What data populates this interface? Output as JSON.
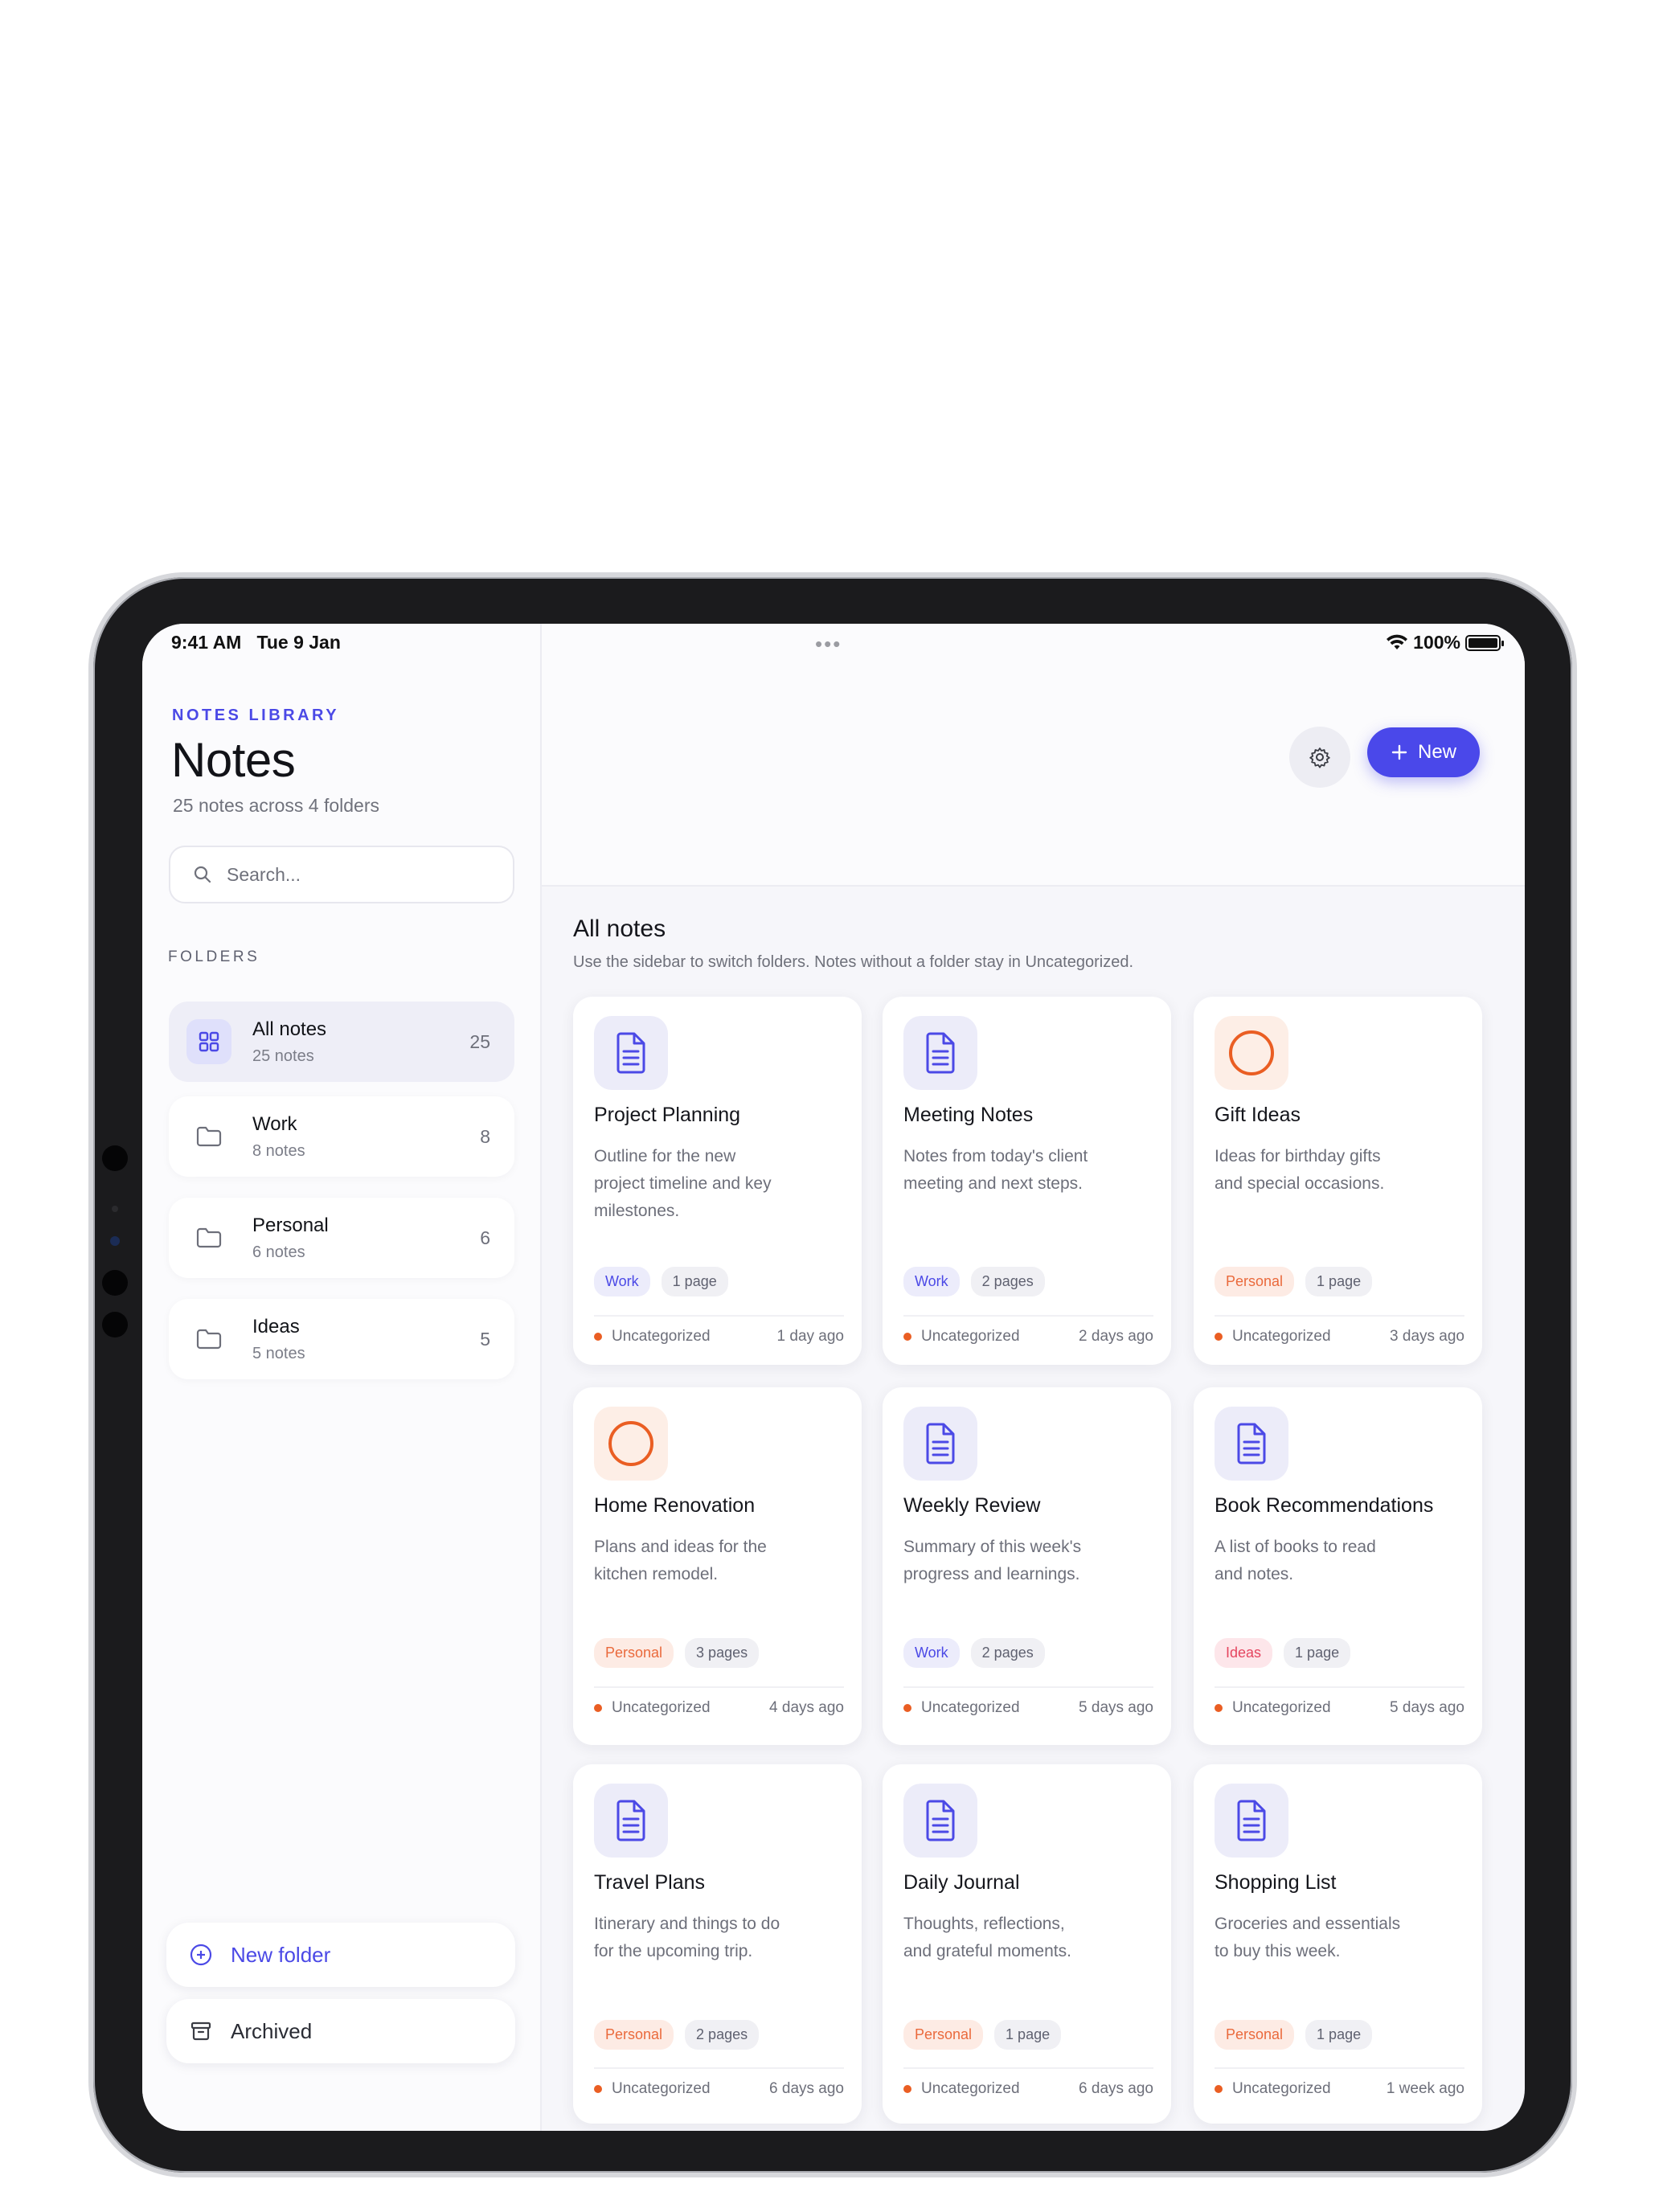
{
  "status": {
    "time": "9:41 AM",
    "date": "Tue 9 Jan",
    "more": "•••",
    "battery": "100%",
    "battery_level": 1.0
  },
  "sidebar": {
    "eyebrow": "NOTES LIBRARY",
    "title": "Notes",
    "subtitle": "25 notes across 4 folders",
    "search_placeholder": "Search...",
    "folders_label": "FOLDERS",
    "folders": [
      {
        "name": "All notes",
        "sub": "25 notes",
        "count": "25",
        "icon": "grid-icon",
        "active": true
      },
      {
        "name": "Work",
        "sub": "8 notes",
        "count": "8",
        "icon": "folder-icon",
        "active": false
      },
      {
        "name": "Personal",
        "sub": "6 notes",
        "count": "6",
        "icon": "folder-icon",
        "active": false
      },
      {
        "name": "Ideas",
        "sub": "5 notes",
        "count": "5",
        "icon": "folder-icon",
        "active": false
      }
    ],
    "new_folder_label": "New folder",
    "archived_label": "Archived"
  },
  "toolbar": {
    "new_label": "New",
    "settings_icon": "gear-icon"
  },
  "main": {
    "title": "All notes",
    "subtitle": "Use the sidebar to switch folders. Notes without a folder stay in Uncategorized.",
    "cards": [
      {
        "title": "Project Planning",
        "desc": "Outline for the new project timeline and key milestones.",
        "tag": "Work",
        "tag_type": "work",
        "pages": "1 page",
        "folder": "Uncategorized",
        "time": "1 day ago",
        "icon": "document-icon"
      },
      {
        "title": "Meeting Notes",
        "desc": "Notes from today's client meeting and next steps.",
        "tag": "Work",
        "tag_type": "work",
        "pages": "2 pages",
        "folder": "Uncategorized",
        "time": "2 days ago",
        "icon": "document-icon"
      },
      {
        "title": "Gift Ideas",
        "desc": "Ideas for birthday gifts and special occasions.",
        "tag": "Personal",
        "tag_type": "personal",
        "pages": "1 page",
        "folder": "Uncategorized",
        "time": "3 days ago",
        "icon": "circle-icon"
      },
      {
        "title": "Home Renovation",
        "desc": "Plans and ideas for the kitchen remodel.",
        "tag": "Personal",
        "tag_type": "personal",
        "pages": "3 pages",
        "folder": "Uncategorized",
        "time": "4 days ago",
        "icon": "circle-icon"
      },
      {
        "title": "Weekly Review",
        "desc": "Summary of this week's progress and learnings.",
        "tag": "Work",
        "tag_type": "work",
        "pages": "2 pages",
        "folder": "Uncategorized",
        "time": "5 days ago",
        "icon": "document-icon"
      },
      {
        "title": "Book Recommendations",
        "desc": "A list of books to read and notes.",
        "tag": "Ideas",
        "tag_type": "ideas",
        "pages": "1 page",
        "folder": "Uncategorized",
        "time": "5 days ago",
        "icon": "document-icon"
      },
      {
        "title": "Travel Plans",
        "desc": "Itinerary and things to do for the upcoming trip.",
        "tag": "Personal",
        "tag_type": "personal",
        "pages": "2 pages",
        "folder": "Uncategorized",
        "time": "6 days ago",
        "icon": "document-icon"
      },
      {
        "title": "Daily Journal",
        "desc": "Thoughts, reflections, and grateful moments.",
        "tag": "Personal",
        "tag_type": "personal",
        "pages": "1 page",
        "folder": "Uncategorized",
        "time": "6 days ago",
        "icon": "document-icon"
      },
      {
        "title": "Shopping List",
        "desc": "Groceries and essentials to buy this week.",
        "tag": "Personal",
        "tag_type": "personal",
        "pages": "1 page",
        "folder": "Uncategorized",
        "time": "1 week ago",
        "icon": "document-icon"
      }
    ]
  },
  "colors": {
    "accent": "#4a48ea",
    "orange": "#ea6a3c",
    "ideas": "#e5455f"
  }
}
